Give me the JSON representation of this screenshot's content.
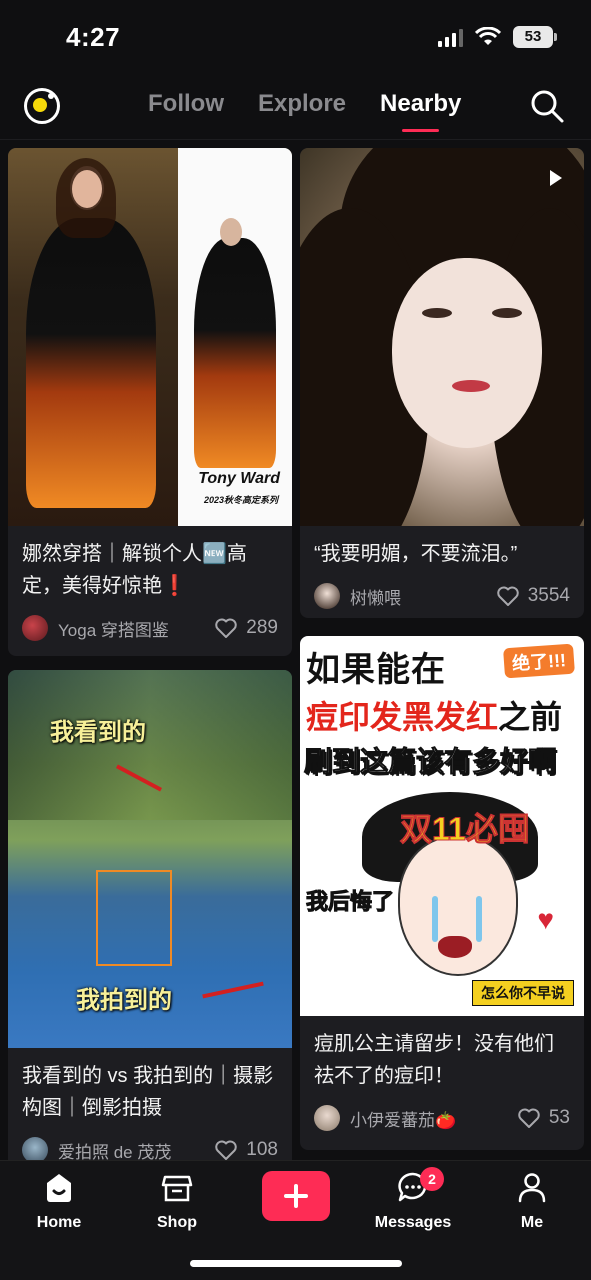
{
  "status_bar": {
    "time": "4:27",
    "battery": "53"
  },
  "topnav": {
    "tabs": [
      {
        "label": "Follow",
        "active": false
      },
      {
        "label": "Explore",
        "active": false
      },
      {
        "label": "Nearby",
        "active": true
      }
    ]
  },
  "feed": {
    "cards": [
      {
        "title": "娜然穿搭｜解锁个人🆕高定，美得好惊艳❗",
        "author": "Yoga 穿搭图鉴",
        "likes": "289",
        "overlay_text": [
          "Tony Ward",
          "2023秋冬高定系列"
        ]
      },
      {
        "title": "“我要明媚，不要流泪。”",
        "author": "树懒喂",
        "likes": "3554",
        "is_video": true
      },
      {
        "title": "我看到的 vs 我拍到的｜摄影构图｜倒影拍摄",
        "author": "爱拍照 de 茂茂",
        "likes": "108",
        "overlay_text": [
          "我看到的",
          "我拍到的"
        ]
      },
      {
        "title": "痘肌公主请留步！没有他们祛不了的痘印！",
        "author": "小伊爱蕃茄🍅",
        "likes": "53",
        "overlay_text": [
          "如果能在",
          "痘印发黑发红",
          "之前",
          "刷到这篇该有多好啊",
          "绝了!!!",
          "双11必囤",
          "我后悔了",
          "怎么你不早说"
        ]
      }
    ]
  },
  "bottom_nav": {
    "items": [
      {
        "label": "Home",
        "icon": "home-icon"
      },
      {
        "label": "Shop",
        "icon": "shop-icon"
      },
      {
        "label": "",
        "icon": "plus-icon"
      },
      {
        "label": "Messages",
        "icon": "chat-icon",
        "badge": "2"
      },
      {
        "label": "Me",
        "icon": "person-icon"
      }
    ]
  },
  "colors": {
    "accent": "#fe2c55",
    "background": "#0f0f11",
    "card": "#1d1d21"
  }
}
